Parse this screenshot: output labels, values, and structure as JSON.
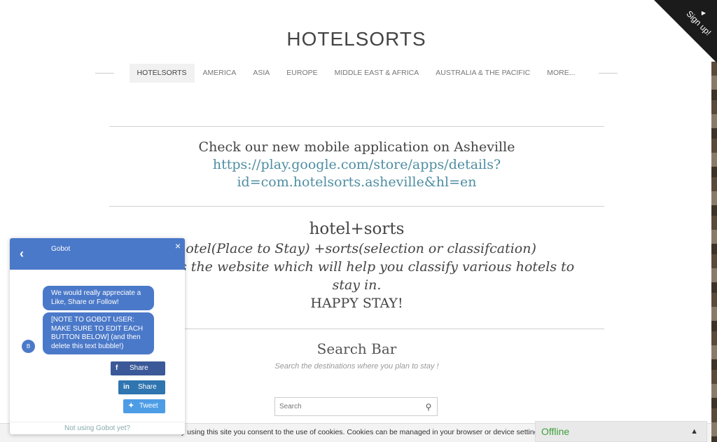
{
  "site": {
    "title": "HOTELSORTS",
    "signup_label": "Sign up!"
  },
  "nav": {
    "items": [
      {
        "label": "HOTELSORTS",
        "active": true
      },
      {
        "label": "AMERICA"
      },
      {
        "label": "ASIA"
      },
      {
        "label": "EUROPE"
      },
      {
        "label": "MIDDLE EAST & AFRICA"
      },
      {
        "label": "AUSTRALIA & THE PACIFIC"
      },
      {
        "label": "MORE..."
      }
    ]
  },
  "promo": {
    "text": "Check our new mobile application on Asheville",
    "link_line1": "https://play.google.com/store/apps/details?",
    "link_line2": "id=com.hotelsorts.asheville&hl=en"
  },
  "about": {
    "heading": "hotel+sorts",
    "definition": "hotel(Place to Stay) +sorts(selection or classifcation)",
    "line1": ".com is the website which will help you classify  various hotels to",
    "line2": "stay in.",
    "line3": "HAPPY STAY!"
  },
  "search": {
    "heading": "Search Bar",
    "subtitle": "Search the destinations where you plan to stay !",
    "placeholder": "Search"
  },
  "cookie": {
    "text": "By using this site you consent to the use of cookies. Cookies can be managed in your browser or device settings."
  },
  "chat_status": {
    "label": "Offline"
  },
  "gobot": {
    "name": "Gobot",
    "avatar_initial": "B",
    "message1": "We would really appreciate a Like, Share or Follow!",
    "message2": "[NOTE TO GOBOT USER: MAKE SURE TO EDIT EACH BUTTON BELOW] (and then delete this text bubble!)",
    "facebook_label": "Share",
    "linkedin_label": "Share",
    "twitter_label": "Tweet",
    "footer": "Not using Gobot yet?"
  },
  "colors": {
    "link": "#4e8ea2",
    "gobot_blue": "#4b79c9",
    "offline_green": "#3da03d"
  }
}
